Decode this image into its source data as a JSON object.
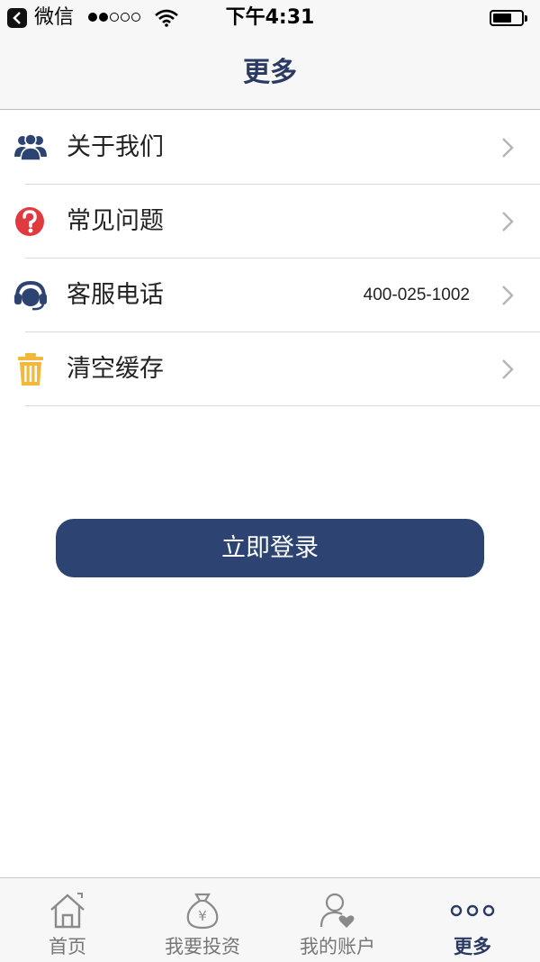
{
  "status_bar": {
    "carrier": "微信",
    "time": "下午4:31"
  },
  "nav": {
    "title": "更多"
  },
  "menu": {
    "items": [
      {
        "label": "关于我们",
        "value": "",
        "icon": "people-icon",
        "icon_color": "#2d4473"
      },
      {
        "label": "常见问题",
        "value": "",
        "icon": "question-icon",
        "icon_color": "#e03a3e"
      },
      {
        "label": "客服电话",
        "value": "400-025-1002",
        "icon": "headset-icon",
        "icon_color": "#2d4473"
      },
      {
        "label": "清空缓存",
        "value": "",
        "icon": "trash-icon",
        "icon_color": "#f3b73b"
      }
    ]
  },
  "login_button": {
    "label": "立即登录",
    "color": "#2d4473"
  },
  "tabbar": {
    "tabs": [
      {
        "label": "首页",
        "icon": "home-icon",
        "active": false
      },
      {
        "label": "我要投资",
        "icon": "money-bag-icon",
        "active": false
      },
      {
        "label": "我的账户",
        "icon": "user-heart-icon",
        "active": false
      },
      {
        "label": "更多",
        "icon": "more-dots-icon",
        "active": true
      }
    ],
    "active_color": "#2b3a63",
    "inactive_color": "#777777"
  }
}
